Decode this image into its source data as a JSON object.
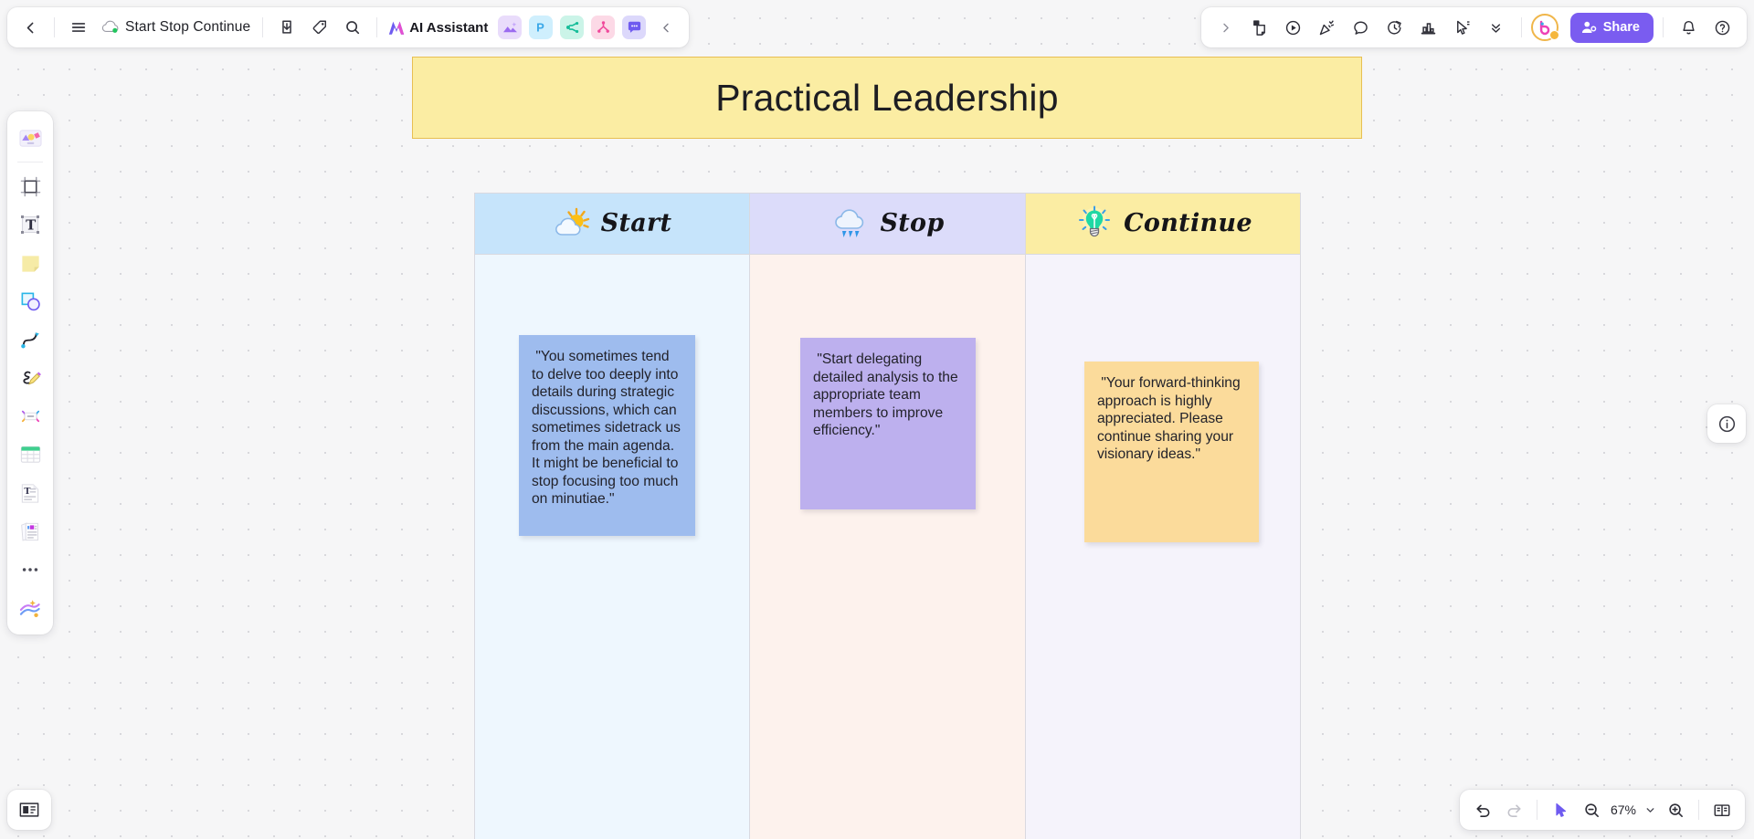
{
  "topbar": {
    "back_icon": "chevron-left-icon",
    "menu_icon": "hamburger-menu-icon",
    "cloud_icon": "cloud-saved-icon",
    "doc_title": "Start Stop Continue",
    "export_icon": "download-export-icon",
    "tag_icon": "tag-icon",
    "search_icon": "search-icon",
    "ai_assistant_label": "AI Assistant",
    "ai_logo_icon": "ai-sparkle-logo-icon",
    "app_icons": [
      {
        "name": "ai-image-icon",
        "glyph": "image"
      },
      {
        "name": "presentation-icon",
        "glyph": "P"
      },
      {
        "name": "mindmap-icon",
        "glyph": "mindmap"
      },
      {
        "name": "flowchart-icon",
        "glyph": "flow"
      },
      {
        "name": "comment-icon",
        "glyph": "chat"
      }
    ],
    "collapse_icon": "chevron-left-collapse-icon"
  },
  "topbar_right": {
    "expand_icon": "chevron-right-icon",
    "tools": [
      {
        "name": "sticky-template-icon"
      },
      {
        "name": "presentation-play-icon"
      },
      {
        "name": "celebrate-confetti-icon"
      },
      {
        "name": "comment-bubble-icon"
      },
      {
        "name": "timer-icon"
      },
      {
        "name": "vote-chart-icon"
      },
      {
        "name": "cursor-pointer-icon"
      }
    ],
    "more_icon": "chevron-double-down-icon",
    "avatar_label": "b",
    "share_label": "Share",
    "share_icon": "share-person-icon",
    "notification_icon": "bell-icon",
    "help_icon": "help-circle-icon",
    "accent_color": "#7a5cf0"
  },
  "left_toolbar": {
    "items": [
      {
        "name": "templates-icon",
        "label": "Templates"
      },
      {
        "name": "frame-icon",
        "label": "Frame"
      },
      {
        "name": "text-icon",
        "label": "Text"
      },
      {
        "name": "sticky-note-icon",
        "label": "Sticky note"
      },
      {
        "name": "shapes-icon",
        "label": "Shapes"
      },
      {
        "name": "connector-curve-icon",
        "label": "Connector"
      },
      {
        "name": "pen-draw-icon",
        "label": "Pen"
      },
      {
        "name": "mindmap-node-icon",
        "label": "Mind map"
      },
      {
        "name": "table-icon",
        "label": "Table"
      },
      {
        "name": "text-document-icon",
        "label": "Document"
      },
      {
        "name": "multi-document-icon",
        "label": "Documents"
      },
      {
        "name": "more-tools-icon",
        "label": "More"
      },
      {
        "name": "ai-tools-icon",
        "label": "AI tools"
      }
    ],
    "bottom_item": {
      "name": "presentation-frames-icon",
      "label": "Slides"
    }
  },
  "right_panel": {
    "info_icon": "info-circle-icon"
  },
  "bottom_bar": {
    "undo_icon": "undo-icon",
    "redo_icon": "redo-icon",
    "cursor_icon": "select-cursor-icon",
    "zoom_out_icon": "zoom-out-icon",
    "zoom_level": "67%",
    "zoom_dropdown_icon": "chevron-down-icon",
    "zoom_in_icon": "zoom-in-icon",
    "fit_screen_icon": "fit-to-screen-icon"
  },
  "board": {
    "title": "Practical Leadership",
    "title_bg": "#fbeda3",
    "title_border": "#e8bf52",
    "columns": [
      {
        "key": "start",
        "title": "Start",
        "icon": "sun-behind-cloud-icon",
        "header_bg": "#c6e4fb",
        "body_bg": "#eef7fe"
      },
      {
        "key": "stop",
        "title": "Stop",
        "icon": "rain-cloud-icon",
        "header_bg": "#dcdcfa",
        "body_bg": "#fdf2ed"
      },
      {
        "key": "continue",
        "title": "Continue",
        "icon": "lightbulb-icon",
        "header_bg": "#fbeda3",
        "body_bg": "#f5f3fb"
      }
    ],
    "notes": [
      {
        "key": "start",
        "color": "#9ebcee",
        "text": " \"You sometimes tend to delve too deeply into details during strategic discussions, which can sometimes sidetrack us from the main agenda. It might be beneficial to stop focusing too much on minutiae.\""
      },
      {
        "key": "stop",
        "color": "#bdb0ee",
        "text": " \"Start delegating detailed analysis to the appropriate team members to improve efficiency.\""
      },
      {
        "key": "continue",
        "color": "#fbdb9b",
        "text": " \"Your forward-thinking approach is highly appreciated. Please continue sharing your visionary ideas.\""
      }
    ]
  }
}
